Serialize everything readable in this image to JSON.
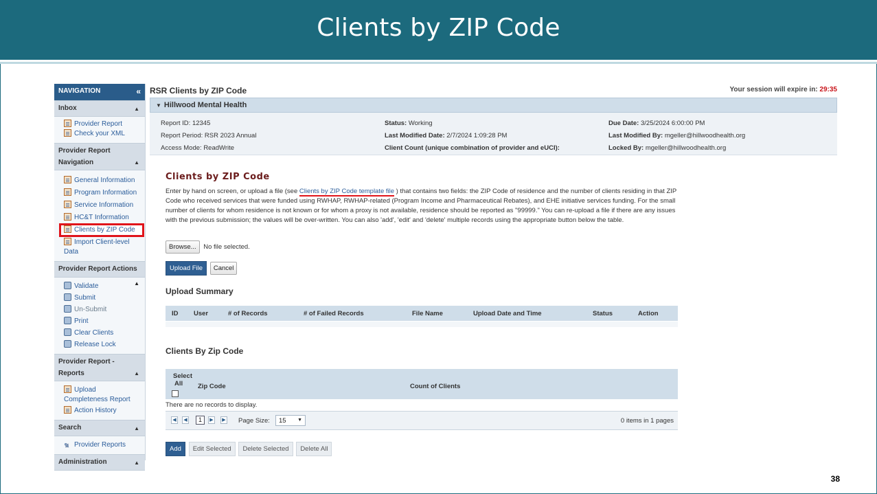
{
  "slide": {
    "title": "Clients by ZIP Code",
    "page_number": "38"
  },
  "nav": {
    "header": "NAVIGATION",
    "collapse_glyph": "«",
    "sections": {
      "inbox": "Inbox",
      "provider_report_navigation_line1": "Provider Report",
      "provider_report_navigation_line2": "Navigation",
      "actions": "Provider Report Actions",
      "reports_line1": "Provider Report -",
      "reports_line2": "Reports",
      "search": "Search",
      "administration": "Administration"
    },
    "inbox_items": [
      "Provider Report",
      "Check your XML"
    ],
    "navigation_items": [
      "General Information",
      "Program Information",
      "Service Information",
      "HC&T Information",
      "Clients by ZIP Code",
      "Import Client-level Data"
    ],
    "action_items": [
      "Validate",
      "Submit",
      "Un-Submit",
      "Print",
      "Clear Clients",
      "Release Lock"
    ],
    "report_items": [
      "Upload Completeness Report",
      "Action History"
    ],
    "search_items": [
      "Provider Reports"
    ]
  },
  "topbar": {
    "heading": "RSR Clients by ZIP Code",
    "session_label": "Your session will expire in:",
    "session_timer": "29:35"
  },
  "provider": {
    "name": "Hillwood Mental Health"
  },
  "info": {
    "report_id_label": "Report ID:",
    "report_id": "12345",
    "report_period_label": "Report Period:",
    "report_period": "RSR 2023 Annual",
    "access_mode_label": "Access Mode:",
    "access_mode": "ReadWrite",
    "status_label": "Status:",
    "status": "Working",
    "last_modified_date_label": "Last Modified Date:",
    "last_modified_date": "2/7/2024  1:09:28 PM",
    "client_count_label": "Client Count (unique combination of provider and eUCI):",
    "due_date_label": "Due Date:",
    "due_date": "3/25/2024  6:00:00 PM",
    "last_modified_by_label": "Last Modified By:",
    "last_modified_by": "mgeller@hillwoodhealth.org",
    "locked_by_label": "Locked By:",
    "locked_by": "mgeller@hillwoodhealth.org"
  },
  "content": {
    "heading": "Clients by ZIP Code",
    "desc_before": "Enter by hand on screen, or upload a file (see ",
    "desc_link": "Clients by ZIP Code template file",
    "desc_after": " ) that contains two fields: the ZIP Code of residence and the number of clients residing in that ZIP Code who received services that were funded using RWHAP, RWHAP-related (Program Income and Pharmaceutical Rebates), and EHE initiative services funding. For the small number of clients for whom residence is not known or for whom a proxy is not available, residence should be reported as \"99999.\" You can re-upload a file if there are any issues with the previous submission; the values will be over-written. You can also 'add', 'edit' and 'delete' multiple records using the appropriate button below the table.",
    "browse_label": "Browse...",
    "no_file": "No file selected.",
    "upload_button": "Upload File",
    "cancel_button": "Cancel",
    "upload_summary_heading": "Upload Summary",
    "upload_columns": [
      "ID",
      "User",
      "# of Records",
      "# of Failed Records",
      "File Name",
      "Upload Date and Time",
      "Status",
      "Action"
    ],
    "cbz_heading": "Clients By Zip Code",
    "select_all_line1": "Select",
    "select_all_line2": "All",
    "zip_col": "Zip Code",
    "count_col": "Count of Clients",
    "no_records": "There are no records to display.",
    "pager": {
      "current_page": "1",
      "page_size_label": "Page Size:",
      "page_size": "15",
      "info": "0 items in 1 pages"
    },
    "actions": {
      "add": "Add",
      "edit_selected": "Edit Selected",
      "delete_selected": "Delete Selected",
      "delete_all": "Delete All"
    }
  }
}
